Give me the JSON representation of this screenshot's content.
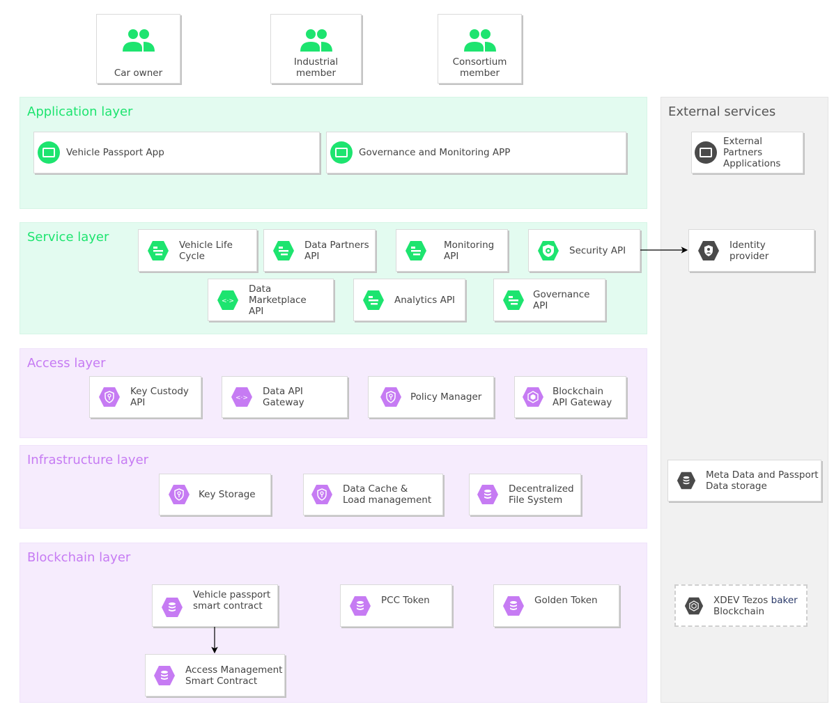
{
  "colors": {
    "green_accent": "#1de46f",
    "purple_accent": "#c67bf3",
    "dark_icon": "#4a4a4a",
    "green_layer_bg": "#e3fbf0",
    "purple_layer_bg": "#f6ecfd",
    "grey_layer_bg": "#f1f1f1"
  },
  "actors": [
    {
      "label": "Car owner",
      "icon": "users-icon"
    },
    {
      "label": "Industrial\nmember",
      "icon": "users-icon"
    },
    {
      "label": "Consortium\nmember",
      "icon": "users-icon"
    }
  ],
  "layers": {
    "application": {
      "title": "Application layer",
      "items": [
        {
          "label": "Vehicle Passport App",
          "icon": "app-window-icon"
        },
        {
          "label": "Governance and Monitoring APP",
          "icon": "app-window-icon"
        }
      ]
    },
    "service": {
      "title": "Service layer",
      "items": [
        {
          "label": "Vehicle Life\nCycle",
          "icon": "list-hex-icon"
        },
        {
          "label": "Data Partners\nAPI",
          "icon": "list-hex-icon"
        },
        {
          "label": "Monitoring API",
          "icon": "list-hex-icon"
        },
        {
          "label": "Security API",
          "icon": "security-hex-icon"
        },
        {
          "label": "Data\nMarketplace\nAPI",
          "icon": "api-hex-icon"
        },
        {
          "label": "Analytics API",
          "icon": "list-hex-icon"
        },
        {
          "label": "Governance API",
          "icon": "list-hex-icon"
        }
      ]
    },
    "access": {
      "title": "Access layer",
      "items": [
        {
          "label": "Key Custody\nAPI",
          "icon": "key-shield-hex-icon"
        },
        {
          "label": "Data API\nGateway",
          "icon": "api-hex-icon"
        },
        {
          "label": "Policy Manager",
          "icon": "key-shield-hex-icon"
        },
        {
          "label": "Blockchain\nAPI Gateway",
          "icon": "cube-hex-icon"
        }
      ]
    },
    "infrastructure": {
      "title": "Infrastructure layer",
      "items": [
        {
          "label": "Key Storage",
          "icon": "key-shield-hex-icon"
        },
        {
          "label": "Data Cache &\nLoad management",
          "icon": "key-shield-hex-icon"
        },
        {
          "label": "Decentralized\nFile System",
          "icon": "storage-hex-icon"
        }
      ]
    },
    "blockchain": {
      "title": "Blockchain layer",
      "items": [
        {
          "label": "Vehicle passport\nsmart contract",
          "icon": "storage-hex-icon"
        },
        {
          "label": "PCC Token",
          "icon": "storage-hex-icon"
        },
        {
          "label": "Golden Token",
          "icon": "storage-hex-icon"
        },
        {
          "label": "Access Management\nSmart Contract",
          "icon": "storage-hex-icon"
        }
      ]
    }
  },
  "external": {
    "title": "External services",
    "items": [
      {
        "label": "External Partners\nApplications",
        "icon": "app-window-icon"
      },
      {
        "label": "Identity\nprovider",
        "icon": "identity-hex-icon"
      },
      {
        "label": "Meta Data and Passport\nData storage",
        "icon": "storage-hex-icon"
      },
      {
        "label_part1": "XDEV Tezos ",
        "label_part2": "baker",
        "label_line2": "Blockchain",
        "icon": "cube-hex-icon"
      }
    ]
  },
  "connections": [
    {
      "from": "Security API",
      "to": "Identity provider"
    },
    {
      "from": "Vehicle passport smart contract",
      "to": "Access Management Smart Contract"
    }
  ]
}
